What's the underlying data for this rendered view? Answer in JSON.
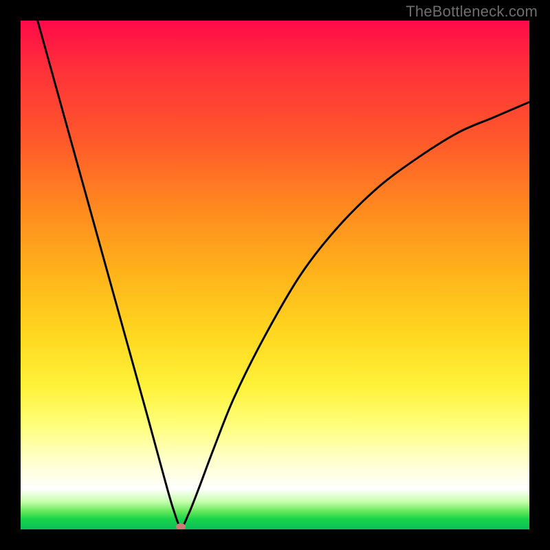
{
  "watermark": "TheBottleneck.com",
  "plot": {
    "background_frame_color": "#000000",
    "curve_stroke": "#000000",
    "curve_stroke_width": 3,
    "lowpoint_color": "#d07a78",
    "gradient_stops": [
      {
        "pct": 0,
        "color": "#ff0a4a"
      },
      {
        "pct": 9,
        "color": "#ff2f3a"
      },
      {
        "pct": 24,
        "color": "#ff5a2a"
      },
      {
        "pct": 37,
        "color": "#ff8a1f"
      },
      {
        "pct": 50,
        "color": "#ffb41a"
      },
      {
        "pct": 62,
        "color": "#ffd820"
      },
      {
        "pct": 72,
        "color": "#fff23a"
      },
      {
        "pct": 80,
        "color": "#ffff80"
      },
      {
        "pct": 86,
        "color": "#ffffc8"
      },
      {
        "pct": 92,
        "color": "#ffffff"
      },
      {
        "pct": 94.5,
        "color": "#c9ffb0"
      },
      {
        "pct": 96.5,
        "color": "#63e85a"
      },
      {
        "pct": 98,
        "color": "#18d44a"
      },
      {
        "pct": 100,
        "color": "#0abf5a"
      }
    ]
  },
  "chart_data": {
    "type": "line",
    "title": "",
    "xlabel": "",
    "ylabel": "",
    "xlim": [
      0,
      100
    ],
    "ylim": [
      0,
      100
    ],
    "series": [
      {
        "name": "bottleneck-curve",
        "x": [
          0,
          5,
          10,
          15,
          20,
          25,
          28,
          30,
          31.5,
          33,
          35,
          38,
          42,
          48,
          55,
          62,
          70,
          78,
          86,
          93,
          100
        ],
        "values": [
          112,
          94,
          76,
          58,
          40,
          22,
          11,
          4,
          0.5,
          3,
          8,
          16,
          26,
          38,
          50,
          59,
          67,
          73,
          78,
          81,
          84
        ]
      }
    ],
    "annotations": [
      {
        "name": "minimum-point",
        "x": 31.5,
        "y": 0.5
      }
    ]
  }
}
